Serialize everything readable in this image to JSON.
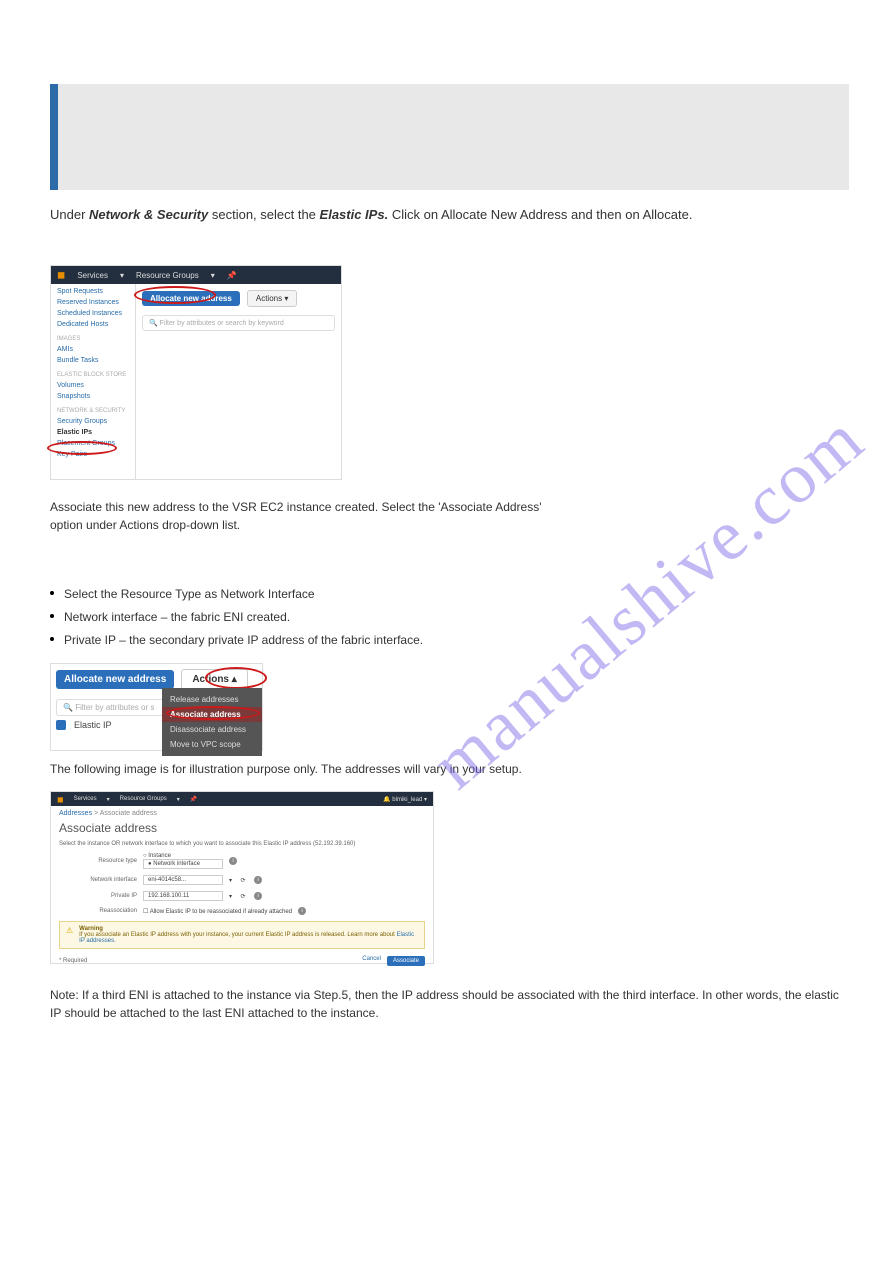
{
  "watermark": "manualshive.com",
  "notebox": {},
  "para1": {
    "prefix": "Under ",
    "b1": "Network & Security",
    "mid": " section, select the ",
    "b2": "Elastic IPs.",
    "suffix": " Click on Allocate New Address and then on Allocate."
  },
  "shot1": {
    "top": {
      "services": "Services",
      "resgroups": "Resource Groups"
    },
    "sidebar": {
      "items_top": [
        "Spot Requests",
        "Reserved Instances",
        "Scheduled Instances",
        "Dedicated Hosts"
      ],
      "group1": "IMAGES",
      "items_g1": [
        "AMIs",
        "Bundle Tasks"
      ],
      "group2": "ELASTIC BLOCK STORE",
      "items_g2": [
        "Volumes",
        "Snapshots"
      ],
      "group3": "NETWORK & SECURITY",
      "items_g3": [
        "Security Groups",
        "Elastic IPs",
        "Placement Groups",
        "Key Pairs"
      ]
    },
    "alloc_label": "Allocate new address",
    "actions_label": "Actions",
    "filter_placeholder": "Filter by attributes or search by keyword"
  },
  "para2_a": "Associate this new address to the VSR EC2 instance created. Select the 'Associate Address'",
  "para2_b": "option under Actions drop-down list.",
  "bullets": {
    "b1": "Select the Resource Type as Network Interface",
    "b2": "Network interface – the fabric ENI created.",
    "b3": "Private IP – the secondary private IP address of the fabric interface."
  },
  "shot2": {
    "alloc_label": "Allocate new address",
    "actions_label": "Actions",
    "filter_placeholder": "Filter by attributes or s",
    "row_label": "Elastic IP",
    "menu": {
      "m1": "Release addresses",
      "m2": "Associate address",
      "m3": "Disassociate address",
      "m4": "Move to VPC scope"
    }
  },
  "para3": "The following image is for illustration purpose only. The addresses will vary in your setup.",
  "shot3": {
    "top": {
      "services": "Services",
      "resgroups": "Resource Groups",
      "right": "blmiki_lead"
    },
    "crumb": {
      "a": "Addresses",
      "b": "Associate address"
    },
    "title": "Associate address",
    "subtitle": "Select the instance OR network interface to which you want to associate this Elastic IP address (52.192.39.160)",
    "form": {
      "rtype_lbl": "Resource type",
      "rtype_a": "Instance",
      "rtype_b": "Network interface",
      "ni_lbl": "Network interface",
      "ni_val": "eni-4014c58...",
      "pip_lbl": "Private IP",
      "pip_val": "192.168.100.11",
      "reassoc_lbl": "Reassociation",
      "reassoc_txt": "Allow Elastic IP to be reassociated if already attached"
    },
    "warn": {
      "title": "Warning",
      "body": "If you associate an Elastic IP address with your instance, your current Elastic IP address is released. Learn more about ",
      "link": "Elastic IP addresses."
    },
    "foot": {
      "req": "* Required",
      "cancel": "Cancel",
      "assoc": "Associate"
    }
  },
  "para4_text": "Note: If a third ENI is attached to the instance via Step.5, then the IP address should be associated with the third interface. In other words, the elastic IP should be attached to the last ENI attached to the instance."
}
